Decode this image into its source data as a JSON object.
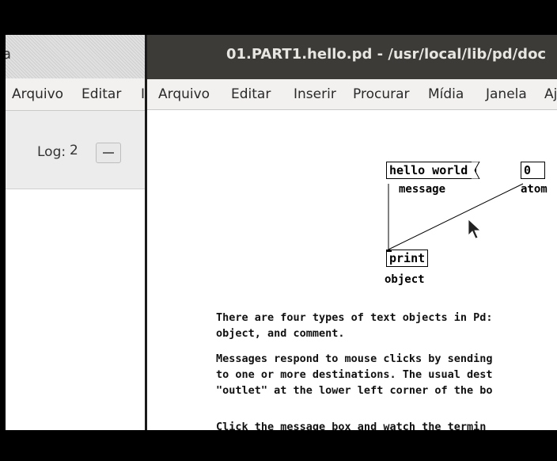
{
  "left_window": {
    "title_fragment": "a",
    "menu": [
      "Arquivo",
      "Editar",
      "I"
    ],
    "log_label": "Log:",
    "log_value": "2"
  },
  "patch_window": {
    "title": "01.PART1.hello.pd  - /usr/local/lib/pd/doc",
    "menu": [
      "Arquivo",
      "Editar",
      "Inserir",
      "Procurar",
      "Mídia",
      "Janela",
      "Aj"
    ]
  },
  "patch": {
    "message_box": "hello world",
    "message_label": "message",
    "atom_box": "0",
    "atom_label": "atom",
    "object_box": "print",
    "object_label": "object"
  },
  "comments": [
    "There are four types of text objects in Pd:",
    "object, and comment.",
    "Messages respond to mouse clicks by sending",
    "to one or more destinations. The usual dest",
    "\"outlet\" at the lower left corner of the bo",
    "Click the message box and watch the termin"
  ]
}
